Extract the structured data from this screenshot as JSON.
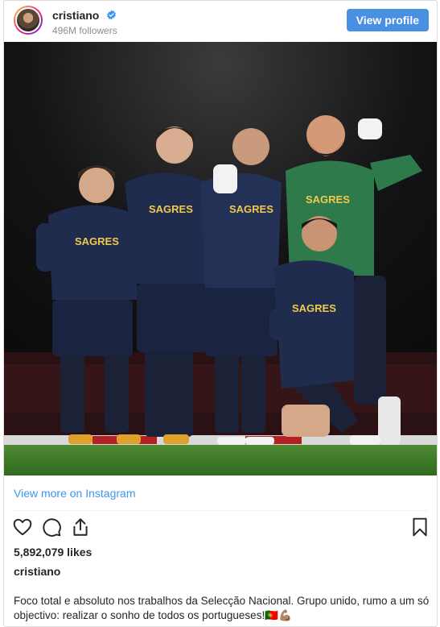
{
  "header": {
    "username": "cristiano",
    "followers": "496M followers",
    "view_profile_label": "View profile"
  },
  "post": {
    "view_more_label": "View more on Instagram",
    "likes": "5,892,079 likes",
    "caption_username": "cristiano",
    "caption_text": "Foco total e absoluto nos trabalhos da Selecção Nacional. Grupo unido, rumo a um só objectivo: realizar o sonho de todos os portugueses!🇵🇹💪🏽",
    "shirt_text": "SAGRES"
  },
  "icons": {
    "verified": "verified-badge-icon",
    "like": "heart-icon",
    "comment": "comment-icon",
    "share": "share-icon",
    "save": "bookmark-icon"
  },
  "colors": {
    "accent": "#4a90e2",
    "link": "#3897f0",
    "verified": "#3897f0"
  }
}
